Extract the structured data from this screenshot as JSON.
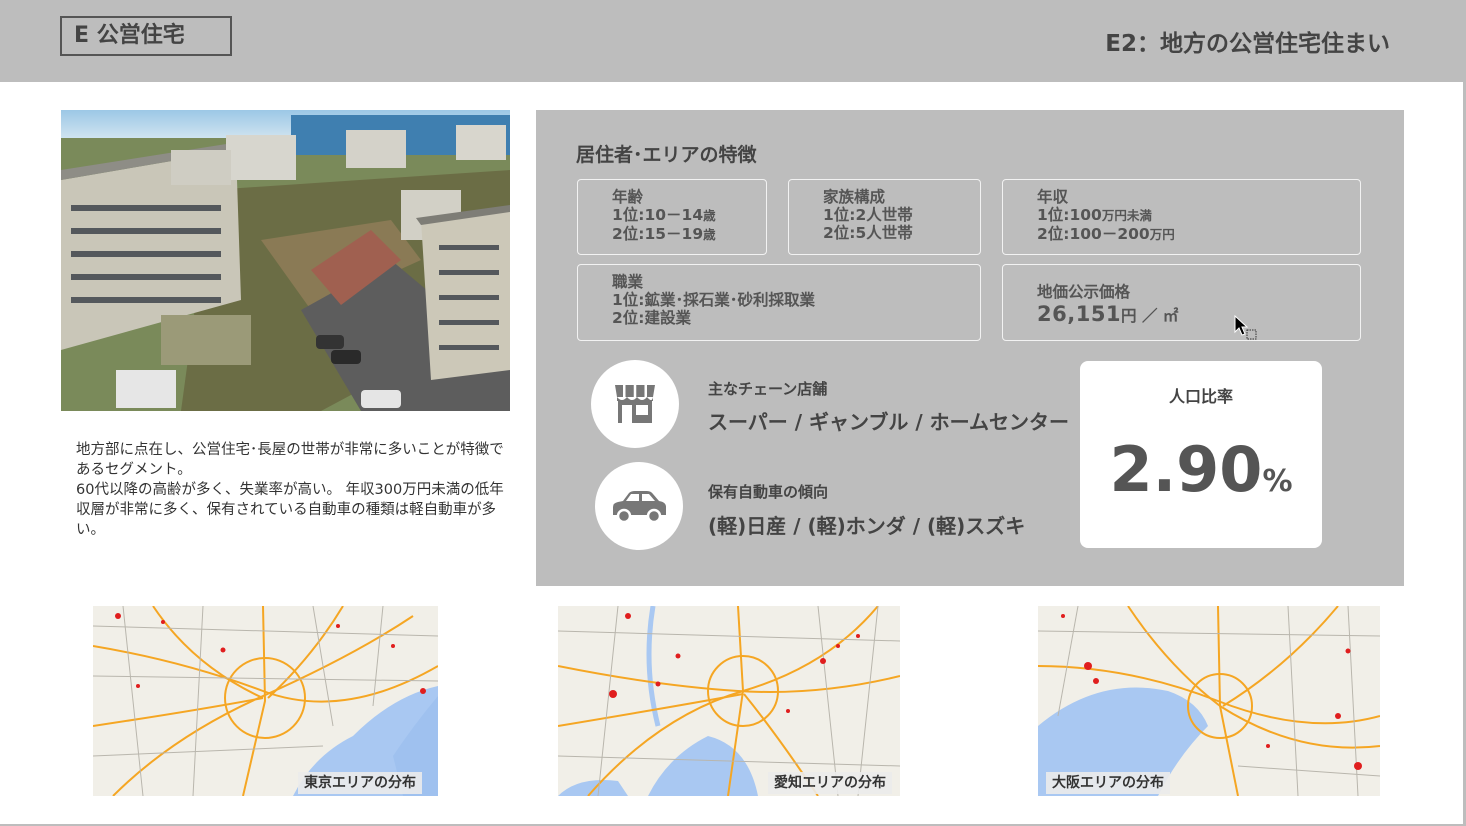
{
  "header": {
    "segment_tag": "E 公営住宅",
    "title": "E2：地方の公営住宅住まい"
  },
  "description": [
    "地方部に点在し、公営住宅･長屋の世帯が非常に多いことが特徴であるセグメント。",
    "60代以降の高齢が多く、失業率が高い。 年収300万円未満の低年収層が非常に多く、保有されている自動車の種類は軽自動車が多い。"
  ],
  "panel": {
    "title": "居住者･エリアの特徴",
    "age": {
      "label": "年齢",
      "rank1": "1位:10－14",
      "rank1_unit": "歳",
      "rank2": "2位:15－19",
      "rank2_unit": "歳"
    },
    "family": {
      "label": "家族構成",
      "rank1": "1位:2人世帯",
      "rank2": "2位:5人世帯"
    },
    "income": {
      "label": "年収",
      "rank1": "1位:100",
      "rank1_unit": "万円未満",
      "rank2": "2位:100－200",
      "rank2_unit": "万円"
    },
    "occupation": {
      "label": "職業",
      "rank1": "1位:鉱業･採石業･砂利採取業",
      "rank2": "2位:建設業"
    },
    "land_price": {
      "label": "地価公示価格",
      "value": "26,151",
      "unit": "円 ／ ㎡"
    },
    "chain_stores": {
      "label": "主なチェーン店舗",
      "value": "スーパー / ギャンブル / ホームセンター",
      "icon": "store-icon"
    },
    "cars": {
      "label": "保有自動車の傾向",
      "value": "(軽)日産 / (軽)ホンダ / (軽)スズキ",
      "icon": "car-icon"
    },
    "population_ratio": {
      "label": "人口比率",
      "value": "2.90",
      "unit": "%"
    }
  },
  "maps": {
    "tokyo": "東京エリアの分布",
    "aichi": "愛知エリアの分布",
    "osaka": "大阪エリアの分布"
  },
  "colors": {
    "header_bg": "#bdbdbd",
    "panel_bg": "#bdbdbd",
    "text": "#444444",
    "map_water": "#a9c8f2",
    "map_road": "#f5a623",
    "map_highlight": "#e01e1e"
  }
}
